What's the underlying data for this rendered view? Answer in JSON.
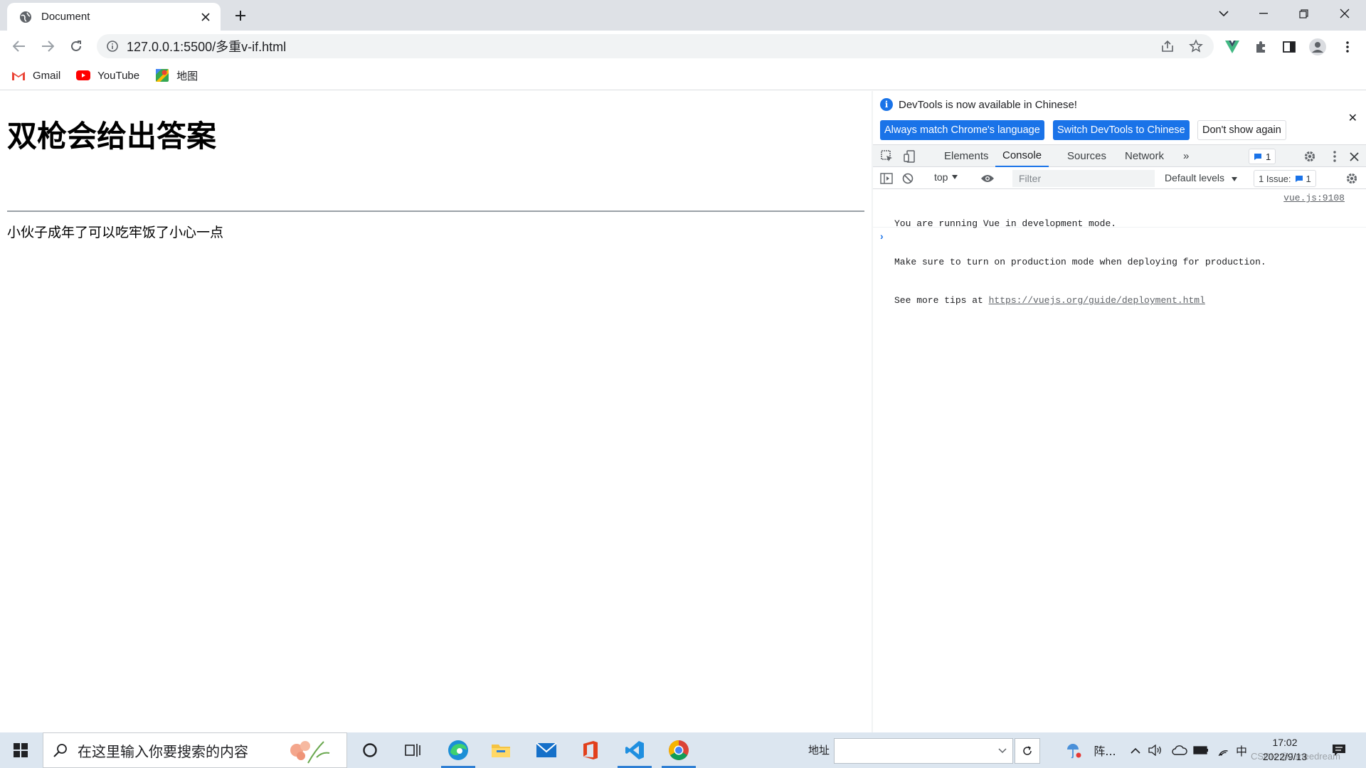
{
  "browser": {
    "tab_title": "Document",
    "url": "127.0.0.1:5500/多重v-if.html",
    "bookmarks": [
      "Gmail",
      "YouTube",
      "地图"
    ]
  },
  "page": {
    "heading": "双枪会给出答案",
    "paragraph": "小伙子成年了可以吃牢饭了小心一点"
  },
  "devtools": {
    "info_message": "DevTools is now available in Chinese!",
    "btn_match": "Always match Chrome's language",
    "btn_switch": "Switch DevTools to Chinese",
    "btn_dont_show": "Don't show again",
    "tabs": [
      "Elements",
      "Console",
      "Sources",
      "Network"
    ],
    "active_tab": "Console",
    "issues_count": "1",
    "context": "top",
    "filter_placeholder": "Filter",
    "levels": "Default levels",
    "issues_label": "1 Issue:",
    "issues_badge": "1",
    "console": {
      "line1": "You are running Vue in development mode.",
      "line2": "Make sure to turn on production mode when deploying for production.",
      "line3_prefix": "See more tips at ",
      "line3_link": "https://vuejs.org/guide/deployment.html",
      "source": "vue.js:9108"
    },
    "prompt": "›"
  },
  "taskbar": {
    "search_placeholder": "在这里输入你要搜索的内容",
    "address_label": "地址",
    "weather_text": "阵...",
    "ime": "中",
    "time": "17:02",
    "date": "2022/9/13",
    "watermark": "CSDN @Janeedream"
  },
  "colors": {
    "accent": "#1a73e8",
    "tabstrip": "#dee1e6",
    "taskbar": "#dce6f0"
  }
}
